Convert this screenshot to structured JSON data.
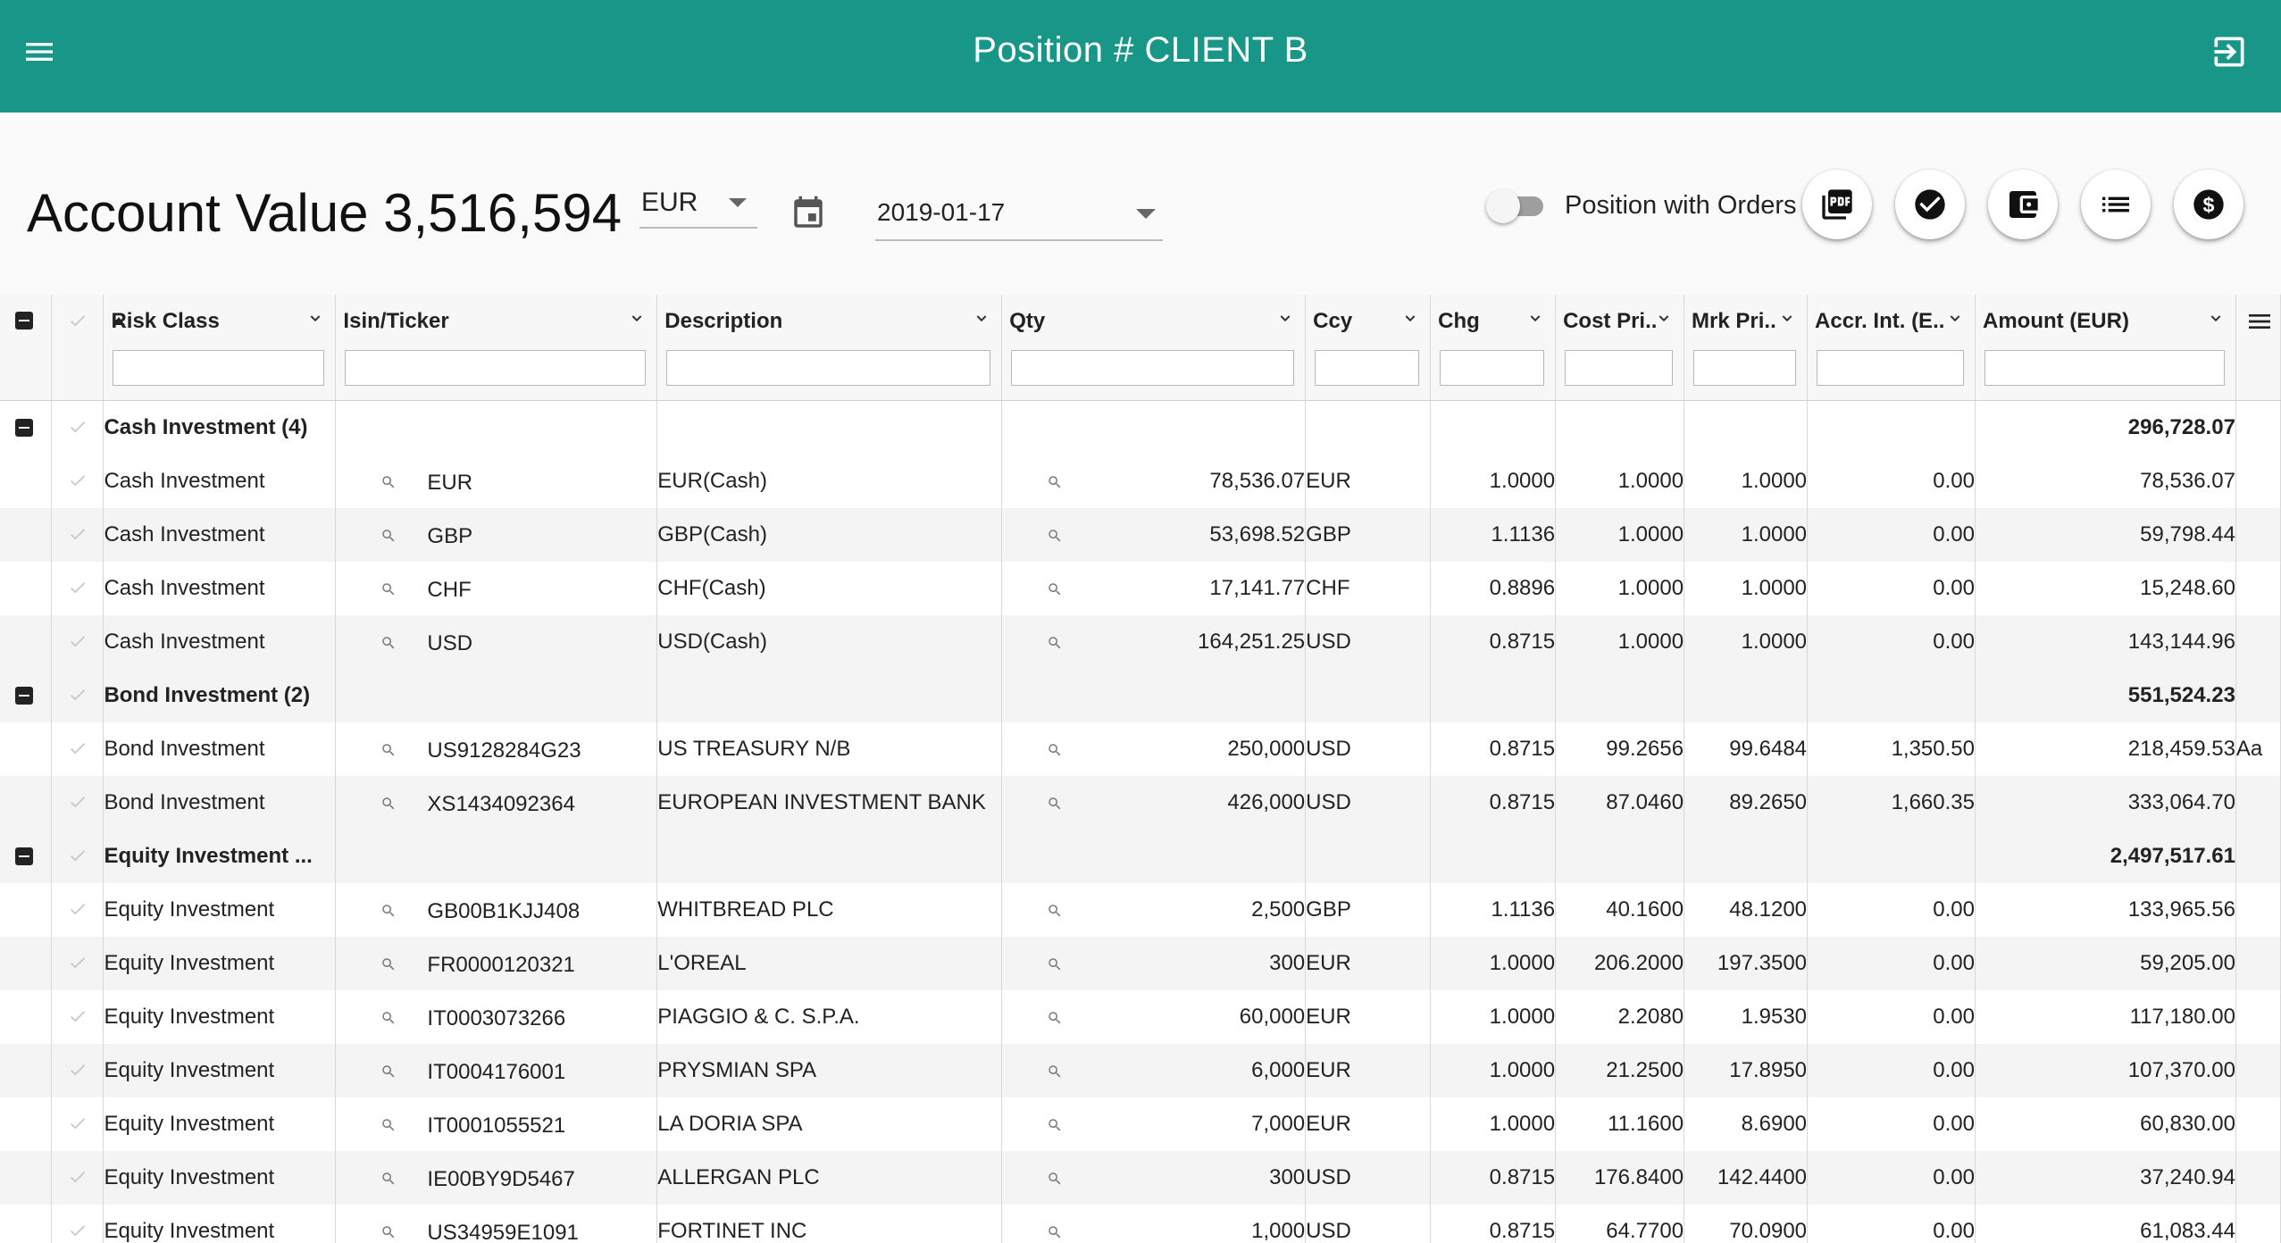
{
  "app_bar": {
    "title": "Position # CLIENT B"
  },
  "toolbar": {
    "account_value_label": "Account Value 3,516,594",
    "currency": "EUR",
    "date": "2019-01-17",
    "toggle_label": "Position with Orders",
    "toggle_on": false,
    "action_icons": [
      "pdf-icon",
      "check-circle-icon",
      "wallet-icon",
      "list-icon",
      "dollar-icon"
    ]
  },
  "grid": {
    "columns": [
      {
        "key": "risk_class",
        "label": "Risk Class",
        "sorted": "asc"
      },
      {
        "key": "isin",
        "label": "Isin/Ticker"
      },
      {
        "key": "description",
        "label": "Description"
      },
      {
        "key": "qty",
        "label": "Qty"
      },
      {
        "key": "ccy",
        "label": "Ccy"
      },
      {
        "key": "chg",
        "label": "Chg"
      },
      {
        "key": "cost_price",
        "label": "Cost Pri.."
      },
      {
        "key": "mrk_price",
        "label": "Mrk Pri.."
      },
      {
        "key": "accr_int",
        "label": "Accr. Int. (E.."
      },
      {
        "key": "amount",
        "label": "Amount (EUR)"
      }
    ],
    "rows": [
      {
        "type": "group",
        "label": "Cash Investment (4)",
        "amount": "296,728.07"
      },
      {
        "type": "row",
        "risk_class": "Cash Investment",
        "isin": "EUR",
        "description": "EUR(Cash)",
        "qty": "78,536.07",
        "ccy": "EUR",
        "chg": "1.0000",
        "cost_price": "1.0000",
        "mrk_price": "1.0000",
        "accr_int": "0.00",
        "amount": "78,536.07",
        "extra": ""
      },
      {
        "type": "row",
        "risk_class": "Cash Investment",
        "isin": "GBP",
        "description": "GBP(Cash)",
        "qty": "53,698.52",
        "ccy": "GBP",
        "chg": "1.1136",
        "cost_price": "1.0000",
        "mrk_price": "1.0000",
        "accr_int": "0.00",
        "amount": "59,798.44",
        "extra": ""
      },
      {
        "type": "row",
        "risk_class": "Cash Investment",
        "isin": "CHF",
        "description": "CHF(Cash)",
        "qty": "17,141.77",
        "ccy": "CHF",
        "chg": "0.8896",
        "cost_price": "1.0000",
        "mrk_price": "1.0000",
        "accr_int": "0.00",
        "amount": "15,248.60",
        "extra": ""
      },
      {
        "type": "row",
        "risk_class": "Cash Investment",
        "isin": "USD",
        "description": "USD(Cash)",
        "qty": "164,251.25",
        "ccy": "USD",
        "chg": "0.8715",
        "cost_price": "1.0000",
        "mrk_price": "1.0000",
        "accr_int": "0.00",
        "amount": "143,144.96",
        "extra": ""
      },
      {
        "type": "group",
        "label": "Bond Investment (2)",
        "amount": "551,524.23"
      },
      {
        "type": "row",
        "risk_class": "Bond Investment",
        "isin": "US9128284G23",
        "description": "US TREASURY N/B",
        "qty": "250,000",
        "ccy": "USD",
        "chg": "0.8715",
        "cost_price": "99.2656",
        "mrk_price": "99.6484",
        "accr_int": "1,350.50",
        "amount": "218,459.53",
        "extra": "Aa"
      },
      {
        "type": "row",
        "risk_class": "Bond Investment",
        "isin": "XS1434092364",
        "description": "EUROPEAN INVESTMENT BANK",
        "qty": "426,000",
        "ccy": "USD",
        "chg": "0.8715",
        "cost_price": "87.0460",
        "mrk_price": "89.2650",
        "accr_int": "1,660.35",
        "amount": "333,064.70",
        "extra": ""
      },
      {
        "type": "group",
        "label": "Equity Investment ...",
        "amount": "2,497,517.61"
      },
      {
        "type": "row",
        "risk_class": "Equity Investment",
        "isin": "GB00B1KJJ408",
        "description": "WHITBREAD PLC",
        "qty": "2,500",
        "ccy": "GBP",
        "chg": "1.1136",
        "cost_price": "40.1600",
        "mrk_price": "48.1200",
        "accr_int": "0.00",
        "amount": "133,965.56",
        "extra": ""
      },
      {
        "type": "row",
        "risk_class": "Equity Investment",
        "isin": "FR0000120321",
        "description": "L'OREAL",
        "qty": "300",
        "ccy": "EUR",
        "chg": "1.0000",
        "cost_price": "206.2000",
        "mrk_price": "197.3500",
        "accr_int": "0.00",
        "amount": "59,205.00",
        "extra": ""
      },
      {
        "type": "row",
        "risk_class": "Equity Investment",
        "isin": "IT0003073266",
        "description": "PIAGGIO & C. S.P.A.",
        "qty": "60,000",
        "ccy": "EUR",
        "chg": "1.0000",
        "cost_price": "2.2080",
        "mrk_price": "1.9530",
        "accr_int": "0.00",
        "amount": "117,180.00",
        "extra": ""
      },
      {
        "type": "row",
        "risk_class": "Equity Investment",
        "isin": "IT0004176001",
        "description": "PRYSMIAN SPA",
        "qty": "6,000",
        "ccy": "EUR",
        "chg": "1.0000",
        "cost_price": "21.2500",
        "mrk_price": "17.8950",
        "accr_int": "0.00",
        "amount": "107,370.00",
        "extra": ""
      },
      {
        "type": "row",
        "risk_class": "Equity Investment",
        "isin": "IT0001055521",
        "description": "LA DORIA SPA",
        "qty": "7,000",
        "ccy": "EUR",
        "chg": "1.0000",
        "cost_price": "11.1600",
        "mrk_price": "8.6900",
        "accr_int": "0.00",
        "amount": "60,830.00",
        "extra": ""
      },
      {
        "type": "row",
        "risk_class": "Equity Investment",
        "isin": "IE00BY9D5467",
        "description": "ALLERGAN PLC",
        "qty": "300",
        "ccy": "USD",
        "chg": "0.8715",
        "cost_price": "176.8400",
        "mrk_price": "142.4400",
        "accr_int": "0.00",
        "amount": "37,240.94",
        "extra": ""
      },
      {
        "type": "row",
        "risk_class": "Equity Investment",
        "isin": "US34959E1091",
        "description": "FORTINET INC",
        "qty": "1,000",
        "ccy": "USD",
        "chg": "0.8715",
        "cost_price": "64.7700",
        "mrk_price": "70.0900",
        "accr_int": "0.00",
        "amount": "61,083.44",
        "extra": ""
      }
    ]
  }
}
